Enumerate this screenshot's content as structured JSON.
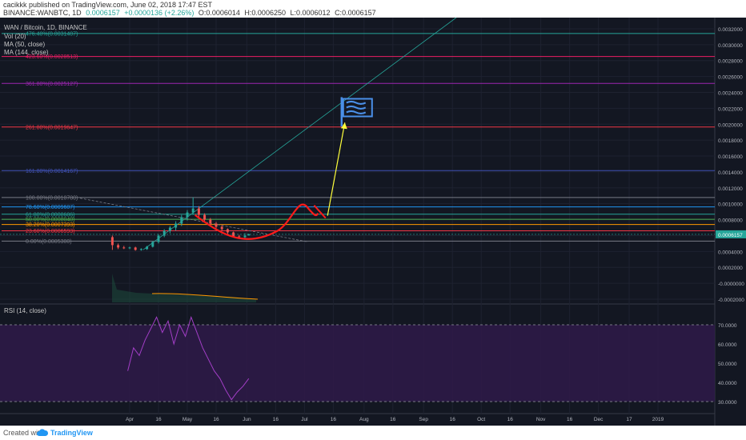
{
  "header": {
    "author": "cacikkk",
    "published_text": "published on TradingView.com, June 02, 2018 17:47 EST",
    "symbol": "BINANCE:WANBTC, 1D",
    "last": "0.0006157",
    "change": "+0.0000136 (+2.26%)",
    "open": "O:0.0006014",
    "high": "H:0.0006250",
    "low": "L:0.0006012",
    "close": "C:0.0006157"
  },
  "legend": {
    "title": "WAN / Bitcoin, 1D, BINANCE",
    "vol": "Vol (20)",
    "ma50": "MA (50, close)",
    "ma144": "MA (144, close)",
    "rsi": "RSI (14, close)"
  },
  "footer": {
    "created_with": "Created with",
    "brand": "TradingView"
  },
  "colors": {
    "background": "#131722",
    "candle_up": "#26a69a",
    "candle_down": "#ef5350",
    "drawing_red": "#ff1a1a",
    "arrow_yellow": "#ffff3b",
    "flag_blue": "#4a8fe8",
    "rsi_line": "#a23ec6",
    "rsi_band": "#2e1a47"
  },
  "chart_data": {
    "type": "candlestick",
    "y_range": [
      -0.0002,
      0.0033
    ],
    "y_ticks": [
      "0.0032000",
      "0.0030000",
      "0.0028000",
      "0.0026000",
      "0.0024000",
      "0.0022000",
      "0.0020000",
      "0.0018000",
      "0.0016000",
      "0.0014000",
      "0.0012000",
      "0.0010000",
      "0.0008000",
      "0.0006000",
      "0.0004000",
      "0.0002000",
      "-0.0000000",
      "-0.0002000"
    ],
    "last_price_label": "0.0006157",
    "x_labels": [
      {
        "label": "Apr",
        "date": "2018-04-01"
      },
      {
        "label": "16",
        "date": "2018-04-16"
      },
      {
        "label": "May",
        "date": "2018-05-01"
      },
      {
        "label": "16",
        "date": "2018-05-16"
      },
      {
        "label": "Jun",
        "date": "2018-06-01"
      },
      {
        "label": "16",
        "date": "2018-06-16"
      },
      {
        "label": "Jul",
        "date": "2018-07-01"
      },
      {
        "label": "16",
        "date": "2018-07-16"
      },
      {
        "label": "Aug",
        "date": "2018-08-01"
      },
      {
        "label": "16",
        "date": "2018-08-16"
      },
      {
        "label": "Sep",
        "date": "2018-09-01"
      },
      {
        "label": "16",
        "date": "2018-09-16"
      },
      {
        "label": "Oct",
        "date": "2018-10-01"
      },
      {
        "label": "16",
        "date": "2018-10-16"
      },
      {
        "label": "Nov",
        "date": "2018-11-01"
      },
      {
        "label": "16",
        "date": "2018-11-16"
      },
      {
        "label": "Dec",
        "date": "2018-12-01"
      },
      {
        "label": "17",
        "date": "2018-12-17"
      },
      {
        "label": "2019",
        "date": "2019-01-01"
      }
    ],
    "fib_levels": [
      {
        "label": "476.40%(0.0031407)",
        "value": 0.0031407,
        "color": "#26a69a"
      },
      {
        "label": "423.60%(0.0028513)",
        "value": 0.0028513,
        "color": "#e91e63"
      },
      {
        "label": "361.80%(0.0025127)",
        "value": 0.0025127,
        "color": "#9c27b0"
      },
      {
        "label": "261.80%(0.0019647)",
        "value": 0.0019647,
        "color": "#f23645"
      },
      {
        "label": "161.80%(0.0014167)",
        "value": 0.0014167,
        "color": "#3f51b5"
      },
      {
        "label": "100.00%(0.0010780)",
        "value": 0.001078,
        "color": "#787b86"
      },
      {
        "label": "78.60%(0.0009607)",
        "value": 0.0009607,
        "color": "#2196f3"
      },
      {
        "label": "61.80%(0.0008686)",
        "value": 0.0008686,
        "color": "#26a69a"
      },
      {
        "label": "50.00%(0.0008040)",
        "value": 0.000804,
        "color": "#4caf50"
      },
      {
        "label": "38.20%(0.0007393)",
        "value": 0.0007393,
        "color": "#ff9800"
      },
      {
        "label": "23.60%(0.0006593)",
        "value": 0.0006593,
        "color": "#f23645"
      },
      {
        "label": "0.00%(0.0005300)",
        "value": 0.00053,
        "color": "#787b86"
      }
    ],
    "candles": [
      {
        "date": "2018-03-23",
        "o": 0.00058,
        "h": 0.0006,
        "l": 0.00042,
        "c": 0.00048
      },
      {
        "date": "2018-03-26",
        "o": 0.00048,
        "h": 0.0005,
        "l": 0.00043,
        "c": 0.00045
      },
      {
        "date": "2018-03-29",
        "o": 0.00045,
        "h": 0.00047,
        "l": 0.00043,
        "c": 0.00044
      },
      {
        "date": "2018-04-01",
        "o": 0.00044,
        "h": 0.00046,
        "l": 0.00043,
        "c": 0.00045
      },
      {
        "date": "2018-04-04",
        "o": 0.00045,
        "h": 0.00046,
        "l": 0.00041,
        "c": 0.00042
      },
      {
        "date": "2018-04-07",
        "o": 0.00042,
        "h": 0.00044,
        "l": 0.00041,
        "c": 0.00043
      },
      {
        "date": "2018-04-10",
        "o": 0.00043,
        "h": 0.00047,
        "l": 0.00042,
        "c": 0.00046
      },
      {
        "date": "2018-04-13",
        "o": 0.00046,
        "h": 0.00053,
        "l": 0.00045,
        "c": 0.00052
      },
      {
        "date": "2018-04-16",
        "o": 0.00052,
        "h": 0.00062,
        "l": 0.0005,
        "c": 0.0006
      },
      {
        "date": "2018-04-19",
        "o": 0.0006,
        "h": 0.00068,
        "l": 0.00058,
        "c": 0.00066
      },
      {
        "date": "2018-04-22",
        "o": 0.00066,
        "h": 0.00072,
        "l": 0.00063,
        "c": 0.0007
      },
      {
        "date": "2018-04-25",
        "o": 0.0007,
        "h": 0.00078,
        "l": 0.00066,
        "c": 0.00075
      },
      {
        "date": "2018-04-28",
        "o": 0.00075,
        "h": 0.00086,
        "l": 0.00072,
        "c": 0.00083
      },
      {
        "date": "2018-05-01",
        "o": 0.00083,
        "h": 0.00092,
        "l": 0.00079,
        "c": 0.00089
      },
      {
        "date": "2018-05-04",
        "o": 0.00089,
        "h": 0.00108,
        "l": 0.00086,
        "c": 0.00094
      },
      {
        "date": "2018-05-07",
        "o": 0.00094,
        "h": 0.00097,
        "l": 0.00083,
        "c": 0.00086
      },
      {
        "date": "2018-05-10",
        "o": 0.00086,
        "h": 0.00088,
        "l": 0.00078,
        "c": 0.0008
      },
      {
        "date": "2018-05-13",
        "o": 0.0008,
        "h": 0.00082,
        "l": 0.00073,
        "c": 0.00075
      },
      {
        "date": "2018-05-16",
        "o": 0.00075,
        "h": 0.00077,
        "l": 0.00069,
        "c": 0.00071
      },
      {
        "date": "2018-05-19",
        "o": 0.00071,
        "h": 0.00073,
        "l": 0.00066,
        "c": 0.00068
      },
      {
        "date": "2018-05-22",
        "o": 0.00068,
        "h": 0.00069,
        "l": 0.00062,
        "c": 0.00064
      },
      {
        "date": "2018-05-25",
        "o": 0.00064,
        "h": 0.00065,
        "l": 0.00058,
        "c": 0.00059
      },
      {
        "date": "2018-05-28",
        "o": 0.00059,
        "h": 0.00061,
        "l": 0.00056,
        "c": 0.00058
      },
      {
        "date": "2018-05-31",
        "o": 0.00058,
        "h": 0.00063,
        "l": 0.00057,
        "c": 0.0006
      },
      {
        "date": "2018-06-02",
        "o": 0.0006014,
        "h": 0.000625,
        "l": 0.0006012,
        "c": 0.0006157
      }
    ],
    "rsi": {
      "range": [
        25,
        75
      ],
      "ticks": [
        "70.0000",
        "60.0000",
        "50.0000",
        "40.0000",
        "30.0000"
      ],
      "band": [
        30,
        70
      ],
      "points": [
        {
          "date": "2018-03-31",
          "v": 46
        },
        {
          "date": "2018-04-03",
          "v": 58
        },
        {
          "date": "2018-04-06",
          "v": 54
        },
        {
          "date": "2018-04-09",
          "v": 62
        },
        {
          "date": "2018-04-12",
          "v": 68
        },
        {
          "date": "2018-04-15",
          "v": 74
        },
        {
          "date": "2018-04-18",
          "v": 66
        },
        {
          "date": "2018-04-21",
          "v": 72
        },
        {
          "date": "2018-04-24",
          "v": 60
        },
        {
          "date": "2018-04-27",
          "v": 70
        },
        {
          "date": "2018-04-30",
          "v": 64
        },
        {
          "date": "2018-05-03",
          "v": 74
        },
        {
          "date": "2018-05-06",
          "v": 66
        },
        {
          "date": "2018-05-09",
          "v": 58
        },
        {
          "date": "2018-05-12",
          "v": 52
        },
        {
          "date": "2018-05-15",
          "v": 46
        },
        {
          "date": "2018-05-18",
          "v": 42
        },
        {
          "date": "2018-05-21",
          "v": 36
        },
        {
          "date": "2018-05-24",
          "v": 31
        },
        {
          "date": "2018-05-27",
          "v": 35
        },
        {
          "date": "2018-05-30",
          "v": 38
        },
        {
          "date": "2018-06-02",
          "v": 42
        }
      ]
    }
  }
}
